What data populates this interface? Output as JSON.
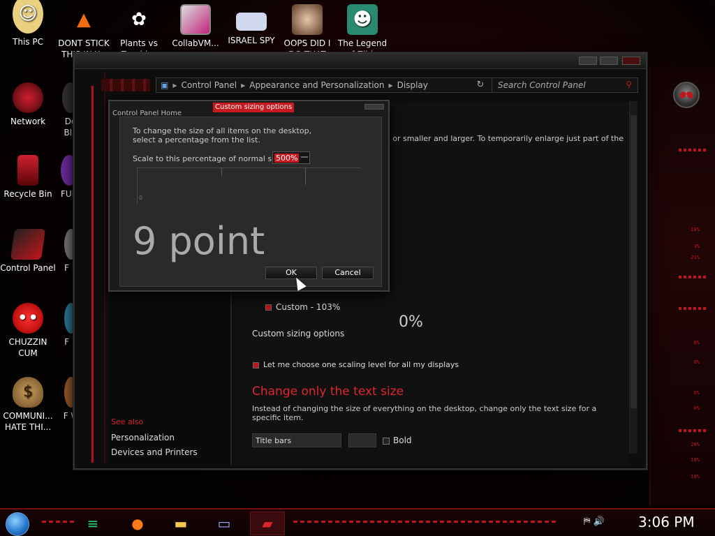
{
  "desktop": {
    "icons": [
      {
        "id": "this-pc",
        "label": "This PC"
      },
      {
        "id": "dont-stick",
        "label": "DONT STICK THIS IN Y..."
      },
      {
        "id": "plants-vs-zombies",
        "label": "Plants vs Zombies"
      },
      {
        "id": "collabvm",
        "label": "CollabVM..."
      },
      {
        "id": "israel-spy",
        "label": "ISRAEL SPY"
      },
      {
        "id": "oops",
        "label": "OOPS DID I DO THAT"
      },
      {
        "id": "legend-zilda",
        "label": "The Legend of Zilda"
      },
      {
        "id": "network",
        "label": "Network"
      },
      {
        "id": "recycle-bin",
        "label": "Recycle Bin"
      },
      {
        "id": "control-panel",
        "label": "Control Panel"
      },
      {
        "id": "chuzzin-cum",
        "label": "CHUZZIN CUM"
      },
      {
        "id": "communi",
        "label": "COMMUNI... HATE THI..."
      }
    ],
    "partial_labels": [
      "Do Bla",
      "FUR",
      "F D",
      "F N",
      "F W"
    ]
  },
  "control_panel": {
    "breadcrumb": [
      "Control Panel",
      "Appearance and Personalization",
      "Display"
    ],
    "search_placeholder": "Search Control Panel",
    "left_pane": {
      "home": "Control Panel Home",
      "see_also": "See also",
      "links": [
        "Personalization",
        "Devices and Printers"
      ]
    },
    "content": {
      "intro_fragment": "s or smaller and larger. To temporarily enlarge just part of the",
      "percent_fragment": "0%",
      "custom_option": "Custom - 103%",
      "custom_sizing_link": "Custom sizing options",
      "scaling_checkbox": "Let me choose one scaling level for all my displays",
      "text_size_heading": "Change only the text size",
      "text_size_desc": "Instead of changing the size of everything on the desktop, change only the text size for a specific item.",
      "item_dropdown": "Title bars",
      "bold_label": "Bold"
    }
  },
  "dialog": {
    "title": "Custom sizing options",
    "instruction": "To change the size of all items on the desktop, select a percentage from the list.",
    "scale_label": "Scale to this percentage of normal size:",
    "scale_value": "500%",
    "ruler_zero": "0",
    "preview_text": "9 point",
    "ok_label": "OK",
    "cancel_label": "Cancel"
  },
  "hud": {
    "readouts": [
      "18%",
      "3%",
      "21%",
      "0%",
      "0%",
      "0%",
      "0%",
      "26%",
      "18%",
      "18%"
    ]
  },
  "taskbar": {
    "clock": "3:06 PM",
    "accent_color": "#c0161b"
  }
}
